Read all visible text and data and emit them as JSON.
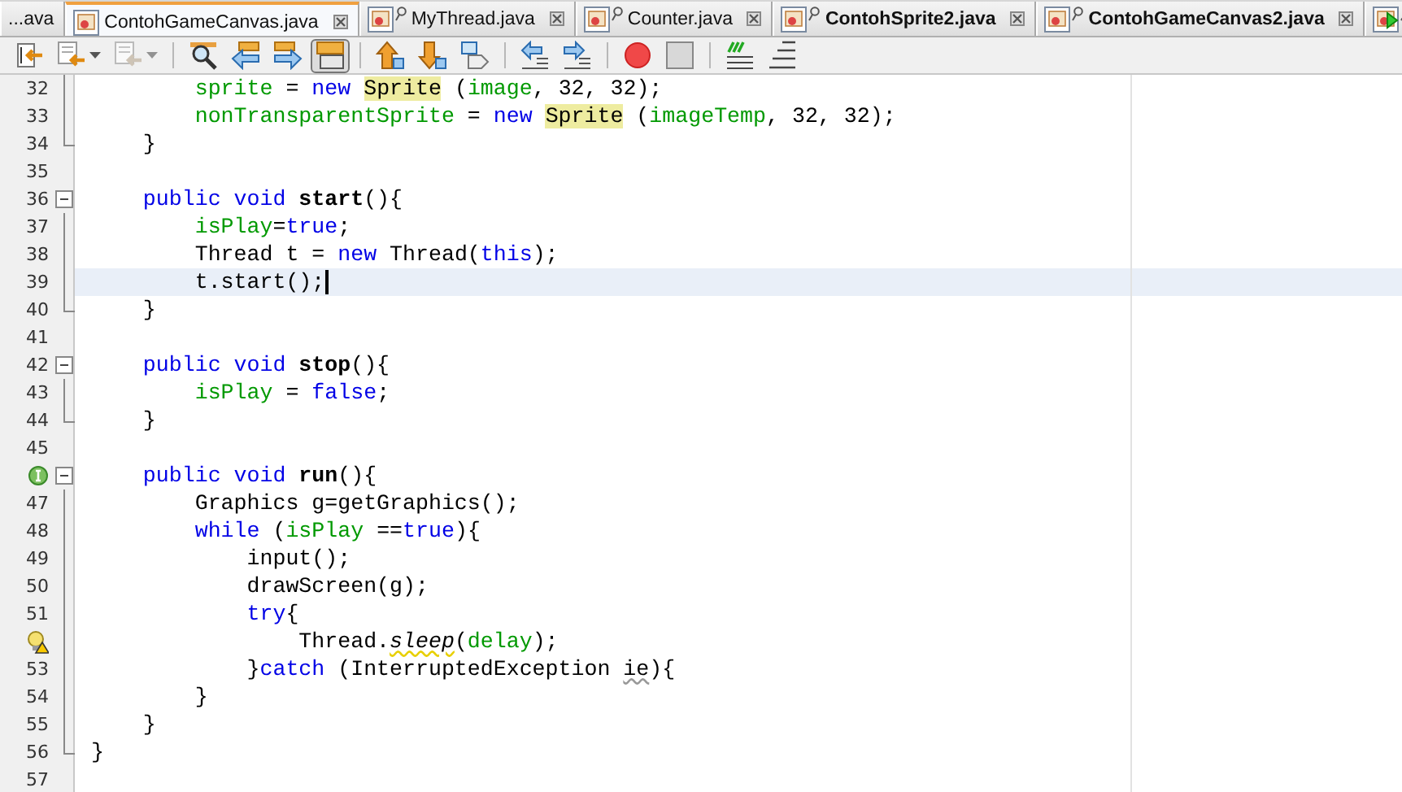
{
  "tabs": [
    {
      "label": "...ava",
      "kind": "cut",
      "selected": false,
      "modified": false
    },
    {
      "label": "ContohGameCanvas.java",
      "kind": "file",
      "selected": true,
      "modified": false
    },
    {
      "label": "MyThread.java",
      "kind": "badge",
      "selected": false,
      "modified": false
    },
    {
      "label": "Counter.java",
      "kind": "badge",
      "selected": false,
      "modified": false
    },
    {
      "label": "ContohSprite2.java",
      "kind": "badge",
      "selected": false,
      "modified": true
    },
    {
      "label": "ContohGameCanvas2.java",
      "kind": "badge",
      "selected": false,
      "modified": true
    },
    {
      "kind": "run",
      "selected": false,
      "modified": false
    }
  ],
  "toolbar": [
    {
      "kind": "last-edit",
      "dropdown": false,
      "disabled": false,
      "pressed": false
    },
    {
      "kind": "back",
      "dropdown": true,
      "disabled": false,
      "pressed": false
    },
    {
      "kind": "forward",
      "dropdown": true,
      "disabled": true,
      "pressed": false
    },
    {
      "kind": "separator"
    },
    {
      "kind": "find-selection",
      "dropdown": false,
      "disabled": false,
      "pressed": false
    },
    {
      "kind": "find-prev",
      "dropdown": false,
      "disabled": false,
      "pressed": false
    },
    {
      "kind": "find-next",
      "dropdown": false,
      "disabled": false,
      "pressed": false
    },
    {
      "kind": "highlight",
      "dropdown": false,
      "disabled": false,
      "pressed": true
    },
    {
      "kind": "separator"
    },
    {
      "kind": "bookmark-prev",
      "dropdown": false,
      "disabled": false,
      "pressed": false
    },
    {
      "kind": "bookmark-next",
      "dropdown": false,
      "disabled": false,
      "pressed": false
    },
    {
      "kind": "bookmark",
      "dropdown": false,
      "disabled": false,
      "pressed": false
    },
    {
      "kind": "separator"
    },
    {
      "kind": "shift-left",
      "dropdown": false,
      "disabled": false,
      "pressed": false
    },
    {
      "kind": "shift-right",
      "dropdown": false,
      "disabled": false,
      "pressed": false
    },
    {
      "kind": "separator"
    },
    {
      "kind": "record",
      "dropdown": false,
      "disabled": false,
      "pressed": false
    },
    {
      "kind": "stop",
      "dropdown": false,
      "disabled": false,
      "pressed": false
    },
    {
      "kind": "separator"
    },
    {
      "kind": "comment",
      "dropdown": false,
      "disabled": false,
      "pressed": false
    },
    {
      "kind": "uncomment",
      "dropdown": false,
      "disabled": false,
      "pressed": false
    }
  ],
  "lines": [
    {
      "number": "32",
      "kind": "fold-body",
      "selected": false,
      "tokens": [
        {
          "text": "        sprite",
          "kind": "field"
        },
        {
          "text": " = ",
          "kind": "plain"
        },
        {
          "text": "new ",
          "kind": "kw"
        },
        {
          "text": "Sprite",
          "kind": "hl"
        },
        {
          "text": " (",
          "kind": "plain"
        },
        {
          "text": "image",
          "kind": "field"
        },
        {
          "text": ", 32, 32);",
          "kind": "plain"
        }
      ]
    },
    {
      "number": "33",
      "kind": "fold-body",
      "selected": false,
      "tokens": [
        {
          "text": "        nonTransparentSprite",
          "kind": "field"
        },
        {
          "text": " = ",
          "kind": "plain"
        },
        {
          "text": "new ",
          "kind": "kw"
        },
        {
          "text": "Sprite",
          "kind": "hl"
        },
        {
          "text": " (",
          "kind": "plain"
        },
        {
          "text": "imageTemp",
          "kind": "field"
        },
        {
          "text": ", 32, 32);",
          "kind": "plain"
        }
      ]
    },
    {
      "number": "34",
      "kind": "fold-end",
      "selected": false,
      "tokens": [
        {
          "text": "    }",
          "kind": "plain"
        }
      ]
    },
    {
      "number": "35",
      "kind": "plain",
      "selected": false
    },
    {
      "number": "36",
      "kind": "fold-start",
      "selected": false,
      "tokens": [
        {
          "text": "    public void ",
          "kind": "kw"
        },
        {
          "text": "start",
          "kind": "decl"
        },
        {
          "text": "(){",
          "kind": "plain"
        }
      ]
    },
    {
      "number": "37",
      "kind": "fold-body",
      "selected": false,
      "tokens": [
        {
          "text": "        isPlay",
          "kind": "field"
        },
        {
          "text": "=",
          "kind": "plain"
        },
        {
          "text": "true",
          "kind": "kw"
        },
        {
          "text": ";",
          "kind": "plain"
        }
      ]
    },
    {
      "number": "38",
      "kind": "fold-body",
      "selected": false,
      "tokens": [
        {
          "text": "        Thread t = ",
          "kind": "plain"
        },
        {
          "text": "new",
          "kind": "kw"
        },
        {
          "text": " Thread(",
          "kind": "plain"
        },
        {
          "text": "this",
          "kind": "kw"
        },
        {
          "text": ");",
          "kind": "plain"
        }
      ]
    },
    {
      "number": "39",
      "kind": "fold-body",
      "selected": true,
      "tokens": [
        {
          "text": "        t.start();",
          "kind": "plain"
        }
      ]
    },
    {
      "number": "40",
      "kind": "fold-end",
      "selected": false,
      "tokens": [
        {
          "text": "    }",
          "kind": "plain"
        }
      ]
    },
    {
      "number": "41",
      "kind": "plain",
      "selected": false
    },
    {
      "number": "42",
      "kind": "fold-start",
      "selected": false,
      "tokens": [
        {
          "text": "    public void ",
          "kind": "kw"
        },
        {
          "text": "stop",
          "kind": "decl"
        },
        {
          "text": "(){",
          "kind": "plain"
        }
      ]
    },
    {
      "number": "43",
      "kind": "fold-body",
      "selected": false,
      "tokens": [
        {
          "text": "        isPlay",
          "kind": "field"
        },
        {
          "text": " = ",
          "kind": "plain"
        },
        {
          "text": "false",
          "kind": "kw"
        },
        {
          "text": ";",
          "kind": "plain"
        }
      ]
    },
    {
      "number": "44",
      "kind": "fold-end",
      "selected": false,
      "tokens": [
        {
          "text": "    }",
          "kind": "plain"
        }
      ]
    },
    {
      "number": "45",
      "kind": "plain",
      "selected": false
    },
    {
      "marker": {
        "kind": "implements"
      },
      "kind": "fold-start",
      "selected": false,
      "tokens": [
        {
          "text": "    public void ",
          "kind": "kw"
        },
        {
          "text": "run",
          "kind": "decl"
        },
        {
          "text": "(){",
          "kind": "plain"
        }
      ]
    },
    {
      "number": "47",
      "kind": "fold-body",
      "selected": false,
      "tokens": [
        {
          "text": "        Graphics g=getGraphics();",
          "kind": "plain"
        }
      ]
    },
    {
      "number": "48",
      "kind": "fold-body",
      "selected": false,
      "tokens": [
        {
          "text": "        while",
          "kind": "kw"
        },
        {
          "text": " (",
          "kind": "plain"
        },
        {
          "text": "isPlay",
          "kind": "field"
        },
        {
          "text": " ==",
          "kind": "plain"
        },
        {
          "text": "true",
          "kind": "kw"
        },
        {
          "text": "){",
          "kind": "plain"
        }
      ]
    },
    {
      "number": "49",
      "kind": "fold-body",
      "selected": false,
      "tokens": [
        {
          "text": "            input();",
          "kind": "plain"
        }
      ]
    },
    {
      "number": "50",
      "kind": "fold-body",
      "selected": false,
      "tokens": [
        {
          "text": "            drawScreen(g);",
          "kind": "plain"
        }
      ]
    },
    {
      "number": "51",
      "kind": "fold-body",
      "selected": false,
      "tokens": [
        {
          "text": "            try",
          "kind": "kw"
        },
        {
          "text": "{",
          "kind": "plain"
        }
      ]
    },
    {
      "marker": {
        "kind": "hint-warning"
      },
      "kind": "fold-body",
      "selected": false,
      "tokens": [
        {
          "text": "                Thread.",
          "kind": "plain"
        },
        {
          "text": "sleep",
          "kind": "static-warn"
        },
        {
          "text": "(",
          "kind": "plain"
        },
        {
          "text": "delay",
          "kind": "field"
        },
        {
          "text": ");",
          "kind": "plain"
        }
      ]
    },
    {
      "number": "53",
      "kind": "fold-body",
      "selected": false,
      "tokens": [
        {
          "text": "            }",
          "kind": "plain"
        },
        {
          "text": "catch",
          "kind": "kw"
        },
        {
          "text": " (InterruptedException ",
          "kind": "plain"
        },
        {
          "text": "ie",
          "kind": "unused"
        },
        {
          "text": "){",
          "kind": "plain"
        }
      ]
    },
    {
      "number": "54",
      "kind": "fold-body",
      "selected": false,
      "tokens": [
        {
          "text": "        }",
          "kind": "plain"
        }
      ]
    },
    {
      "number": "55",
      "kind": "fold-body",
      "selected": false,
      "tokens": [
        {
          "text": "    }",
          "kind": "plain"
        }
      ]
    },
    {
      "number": "56",
      "kind": "fold-end",
      "selected": false,
      "tokens": [
        {
          "text": "}",
          "kind": "plain"
        }
      ]
    },
    {
      "number": "57",
      "kind": "plain",
      "selected": false
    }
  ]
}
